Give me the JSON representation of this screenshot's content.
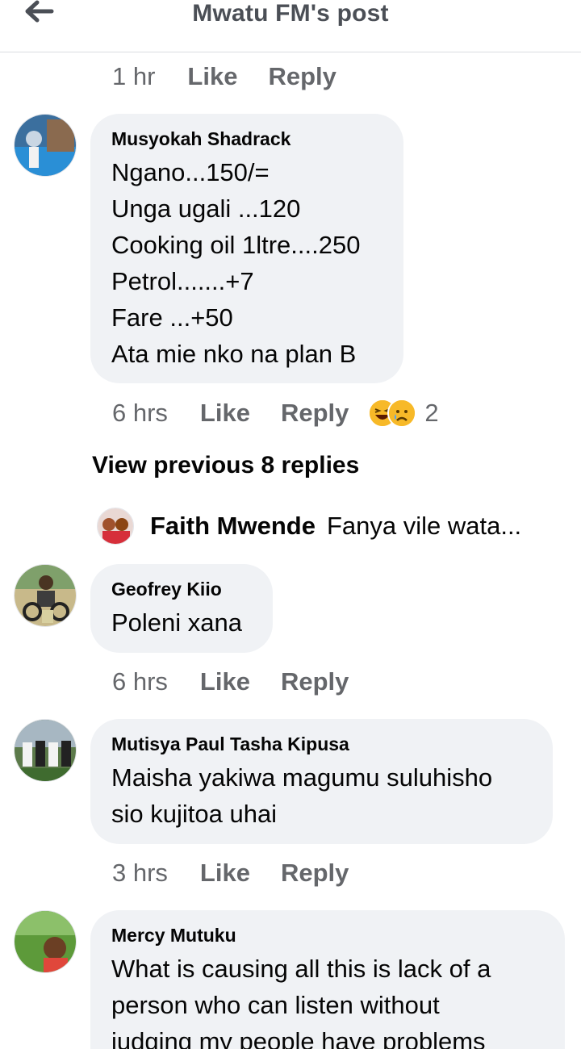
{
  "header": {
    "title": "Mwatu FM's post",
    "back_icon": "arrow-left-icon"
  },
  "top_actions": {
    "time": "1 hr",
    "like": "Like",
    "reply": "Reply"
  },
  "comments": [
    {
      "author": "Musyokah Shadrack",
      "text": "Ngano...150/=\nUnga ugali ...120\nCooking oil 1ltre....250\nPetrol.......+7\nFare ...+50\nAta mie nko na plan B",
      "time": "6 hrs",
      "like": "Like",
      "reply": "Reply",
      "reactions": {
        "icons": [
          "laughing-emoji-icon",
          "crying-emoji-icon"
        ],
        "count": "2"
      }
    },
    {
      "author": "Geofrey Kiio",
      "text": "Poleni xana",
      "time": "6 hrs",
      "like": "Like",
      "reply": "Reply"
    },
    {
      "author": "Mutisya Paul Tasha Kipusa",
      "text": "Maisha yakiwa magumu suluhisho\nsio kujitoa uhai",
      "time": "3 hrs",
      "like": "Like",
      "reply": "Reply"
    },
    {
      "author": "Mercy Mutuku",
      "text": "What is causing  all this  is lack of a\nperson who can listen without\njudging my people have problems"
    }
  ],
  "view_previous": "View previous 8 replies",
  "reply_preview": {
    "author": "Faith Mwende",
    "text": "Fanya vile wata..."
  },
  "colors": {
    "bubble": "#f0f2f5",
    "meta_text": "#65676b",
    "header_text": "#4b4f56",
    "divider": "#dadde1",
    "reaction_yellow": "#f7b928"
  }
}
